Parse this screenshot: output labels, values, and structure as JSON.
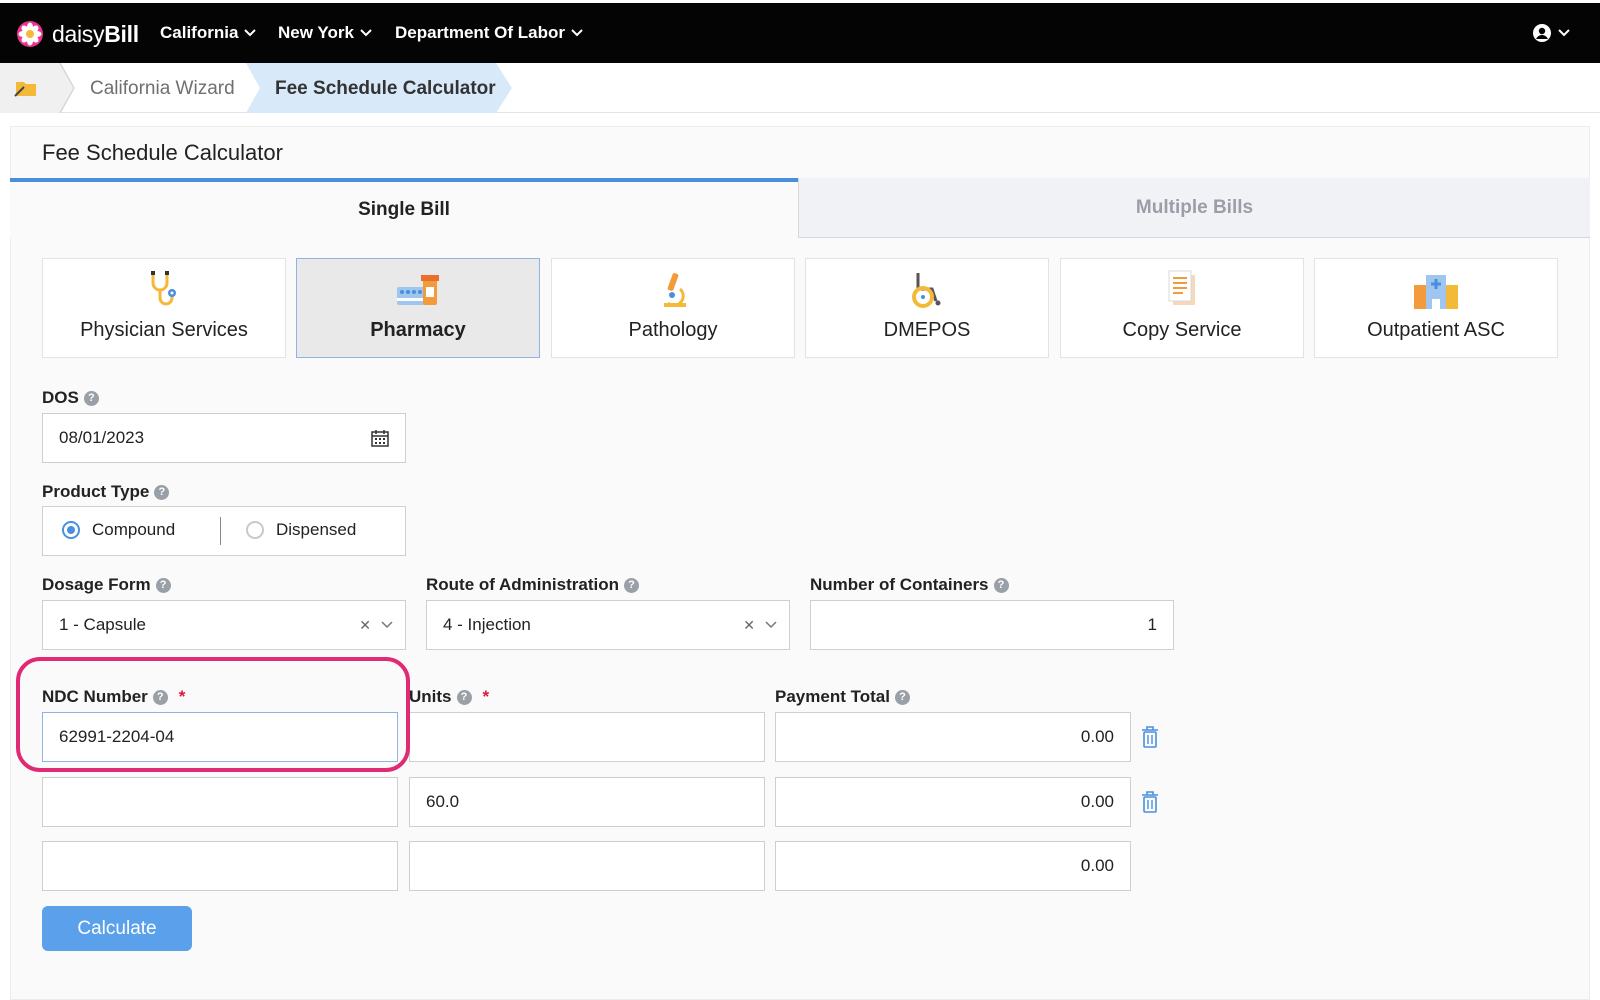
{
  "brand": {
    "name_light": "daisy",
    "name_bold": "Bill"
  },
  "nav": {
    "items": [
      "California",
      "New York",
      "Department Of Labor"
    ]
  },
  "breadcrumb": {
    "items": [
      "California Wizard",
      "Fee Schedule Calculator"
    ]
  },
  "page": {
    "title": "Fee Schedule Calculator"
  },
  "tabs": {
    "single": "Single Bill",
    "multiple": "Multiple Bills"
  },
  "service_types": [
    {
      "label": "Physician Services",
      "icon": "stethoscope-icon"
    },
    {
      "label": "Pharmacy",
      "icon": "pharmacy-icon",
      "selected": true
    },
    {
      "label": "Pathology",
      "icon": "microscope-icon"
    },
    {
      "label": "DMEPOS",
      "icon": "wheelchair-icon"
    },
    {
      "label": "Copy Service",
      "icon": "document-icon"
    },
    {
      "label": "Outpatient ASC",
      "icon": "hospital-icon"
    }
  ],
  "form": {
    "dos_label": "DOS",
    "dos_value": "08/01/2023",
    "product_type_label": "Product Type",
    "product_types": [
      "Compound",
      "Dispensed"
    ],
    "product_type_selected": "Compound",
    "dosage_form_label": "Dosage Form",
    "dosage_form_value": "1 - Capsule",
    "route_label": "Route of Administration",
    "route_value": "4 - Injection",
    "containers_label": "Number of Containers",
    "containers_value": "1",
    "ndc_label": "NDC Number",
    "units_label": "Units",
    "payment_label": "Payment Total",
    "required_mark": "*",
    "rows": [
      {
        "ndc": "62991-2204-04",
        "units": "",
        "payment": "0.00"
      },
      {
        "ndc": "",
        "units": "60.0",
        "payment": "0.00"
      },
      {
        "ndc": "",
        "units": "",
        "payment": "0.00"
      }
    ],
    "calculate_label": "Calculate"
  },
  "colors": {
    "accent": "#4a8fde",
    "highlight": "#e02a73",
    "topbar": "#040404",
    "button": "#5aa0ea"
  }
}
